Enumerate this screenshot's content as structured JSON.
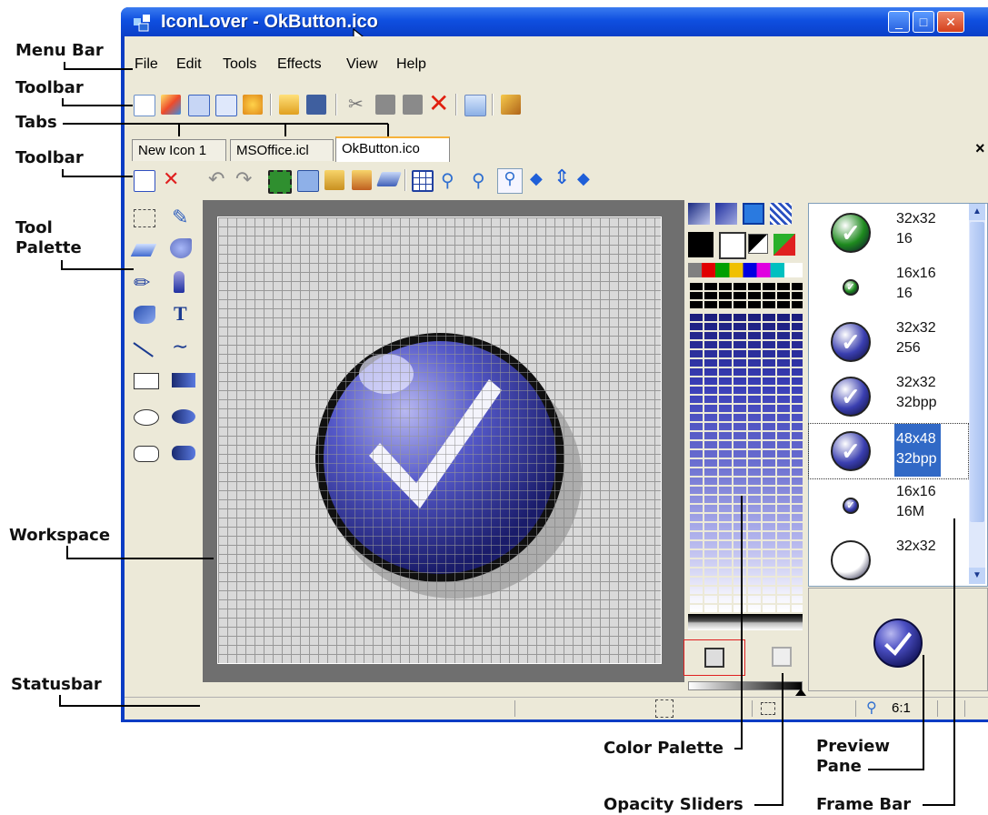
{
  "window": {
    "title": "IconLover - OkButton.ico",
    "minimize_label": "_",
    "maximize_label": "□",
    "close_label": "✕"
  },
  "menu": [
    "File",
    "Edit",
    "Tools",
    "Effects",
    "View",
    "Help"
  ],
  "tabs": [
    "New Icon 1",
    "MSOffice.icl",
    "OkButton.ico"
  ],
  "tab_close_label": "×",
  "tool_palette": {
    "text_tool_label": "T"
  },
  "frames": [
    {
      "size": "32x32",
      "depth": "16",
      "icon_color": "#1e8a1e"
    },
    {
      "size": "16x16",
      "depth": "16",
      "icon_color": "#1e8a1e"
    },
    {
      "size": "32x32",
      "depth": "256",
      "icon_color": "#3a3fb0"
    },
    {
      "size": "32x32",
      "depth": "32bpp",
      "icon_color": "#3a3fb0"
    },
    {
      "size": "48x48",
      "depth": "32bpp",
      "icon_color": "#3a3fb0"
    },
    {
      "size": "16x16",
      "depth": "16M",
      "icon_color": "#3a3fb0"
    },
    {
      "size": "32x32",
      "depth": "",
      "icon_color": "#ffffff"
    }
  ],
  "selected_frame": 4,
  "status": {
    "zoom": "6:1"
  },
  "colors": {
    "title_bar": "#0a3cc4",
    "selection": "#3169c6",
    "icon_blue": "#3a3fb0"
  },
  "callouts": {
    "menu_bar": "Menu Bar",
    "toolbar1": "Toolbar",
    "tabs": "Tabs",
    "toolbar2": "Toolbar",
    "tool_palette": "Tool\nPalette",
    "workspace": "Workspace",
    "statusbar": "Statusbar",
    "color_palette": "Color Palette",
    "opacity_sliders": "Opacity Sliders",
    "preview_pane": "Preview\nPane",
    "frame_bar": "Frame Bar"
  }
}
